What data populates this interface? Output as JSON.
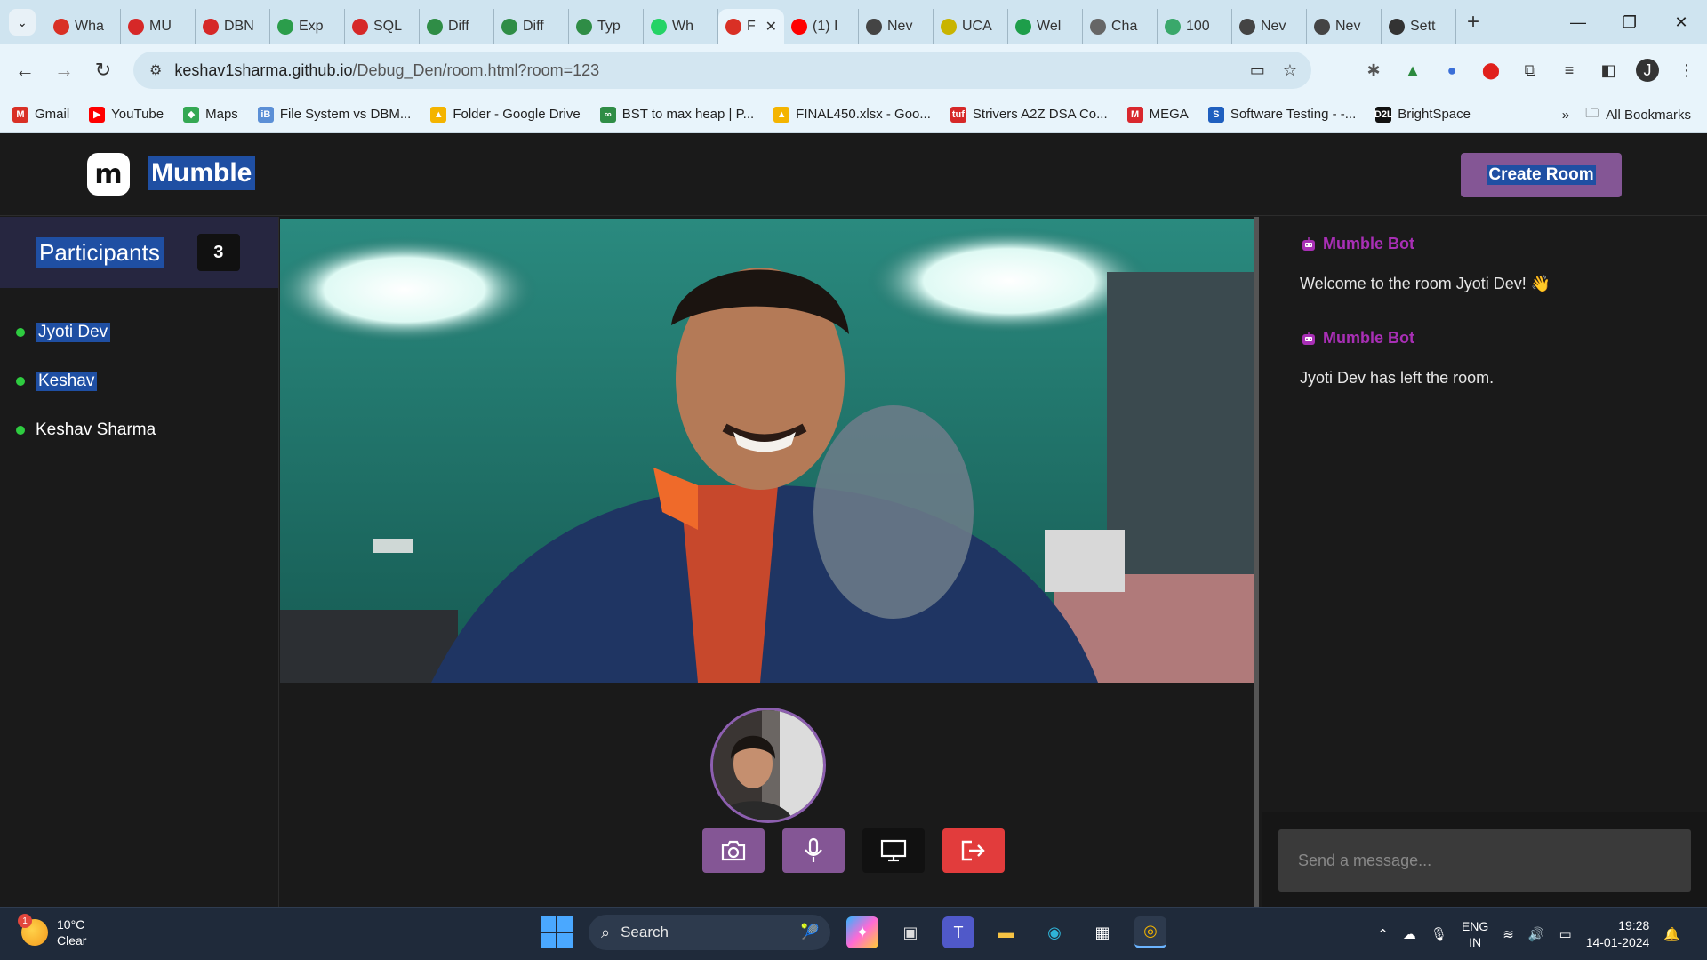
{
  "browser": {
    "tabs": [
      {
        "title": "Wha",
        "icon": "whatsapp-alert-icon",
        "color": "#d93025"
      },
      {
        "title": "MU",
        "icon": "tuf-icon",
        "color": "#d62828"
      },
      {
        "title": "DBN",
        "icon": "v-logo-icon",
        "color": "#d62828"
      },
      {
        "title": "Exp",
        "icon": "green-code-icon",
        "color": "#2b9d4b"
      },
      {
        "title": "SQL",
        "icon": "v-logo-icon",
        "color": "#d62828"
      },
      {
        "title": "Diff",
        "icon": "gfg-icon",
        "color": "#2f8d46"
      },
      {
        "title": "Diff",
        "icon": "gfg-icon",
        "color": "#2f8d46"
      },
      {
        "title": "Typ",
        "icon": "gfg-icon",
        "color": "#2f8d46"
      },
      {
        "title": "Wh",
        "icon": "whatsapp-icon",
        "color": "#25d366"
      },
      {
        "title": "F",
        "icon": "record-icon",
        "color": "#d93025",
        "active": true
      },
      {
        "title": "(1) I",
        "icon": "youtube-icon",
        "color": "#ff0000"
      },
      {
        "title": "Nev",
        "icon": "chatgpt-icon",
        "color": "#444444"
      },
      {
        "title": "UCA",
        "icon": "uca-icon",
        "color": "#c9b400"
      },
      {
        "title": "Wel",
        "icon": "plus-green-icon",
        "color": "#1e9e4a"
      },
      {
        "title": "Cha",
        "icon": "openai-icon",
        "color": "#666666"
      },
      {
        "title": "100",
        "icon": "feather-icon",
        "color": "#3aa86b"
      },
      {
        "title": "Nev",
        "icon": "chatgpt-icon",
        "color": "#444444"
      },
      {
        "title": "Nev",
        "icon": "chatgpt-icon",
        "color": "#444444"
      },
      {
        "title": "Sett",
        "icon": "gear-icon",
        "color": "#333333"
      }
    ],
    "url_host": "keshav1sharma.github.io",
    "url_path": "/Debug_Den/room.html?room=123",
    "bookmarks": [
      {
        "label": "Gmail",
        "color": "#d93025",
        "glyph": "M"
      },
      {
        "label": "YouTube",
        "color": "#ff0000",
        "glyph": "▶"
      },
      {
        "label": "Maps",
        "color": "#34a853",
        "glyph": "◆"
      },
      {
        "label": "File System vs DBM...",
        "color": "#5b8fd6",
        "glyph": "iB"
      },
      {
        "label": "Folder - Google Drive",
        "color": "#f4b400",
        "glyph": "▲"
      },
      {
        "label": "BST to max heap | P...",
        "color": "#2f8d46",
        "glyph": "∞"
      },
      {
        "label": "FINAL450.xlsx - Goo...",
        "color": "#f4b400",
        "glyph": "▲"
      },
      {
        "label": "Strivers A2Z DSA Co...",
        "color": "#d62828",
        "glyph": "tuf"
      },
      {
        "label": "MEGA",
        "color": "#d9272e",
        "glyph": "M"
      },
      {
        "label": "Software Testing - -...",
        "color": "#1f5fbf",
        "glyph": "S"
      },
      {
        "label": "BrightSpace",
        "color": "#111111",
        "glyph": "D2L"
      }
    ],
    "all_bookmarks": "All Bookmarks"
  },
  "app": {
    "brand": "Mumble",
    "create_room": "Create Room",
    "participants_title": "Participants",
    "participants_count": "3",
    "participants": [
      {
        "name": "Jyoti Dev",
        "selected": true
      },
      {
        "name": "Keshav",
        "selected": true
      },
      {
        "name": "Keshav Sharma",
        "selected": false
      }
    ],
    "messages": [
      {
        "sender": "Mumble Bot",
        "text": "Welcome to the room Jyoti Dev! 👋"
      },
      {
        "sender": "Mumble Bot",
        "text": "Jyoti Dev has left the room."
      }
    ],
    "chat_placeholder": "Send a message..."
  },
  "taskbar": {
    "temp": "10°C",
    "condition": "Clear",
    "weather_badge": "1",
    "search": "Search",
    "lang_top": "ENG",
    "lang_bottom": "IN",
    "time": "19:28",
    "date": "14-01-2024"
  },
  "colors": {
    "accent_purple": "#845695",
    "bot_name": "#a82fb5",
    "leave_red": "#e23c3c",
    "online_green": "#2ecc40",
    "highlight_blue": "#1f4fa3"
  }
}
